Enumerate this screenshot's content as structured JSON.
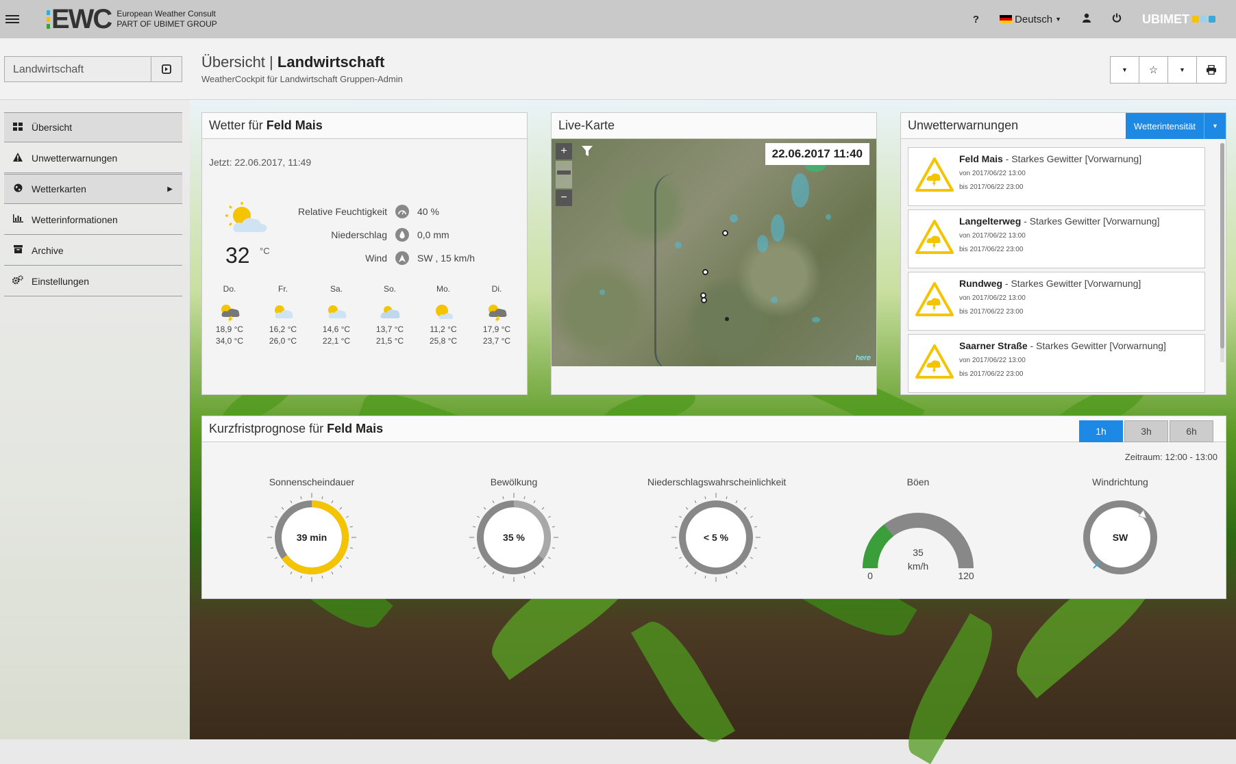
{
  "topbar": {
    "brand": "EWC",
    "brand_sub1": "European Weather Consult",
    "brand_sub2": "PART OF UBIMET GROUP",
    "help": "?",
    "language": "Deutsch",
    "partner": "UBIMET",
    "colors": {
      "bar1": "#3aa8d8",
      "bar2": "#f0c010",
      "bar3": "#3a9e3a"
    }
  },
  "header": {
    "group_select": "Landwirtschaft",
    "title_prefix": "Übersicht",
    "title_sep": "|",
    "title_main": "Landwirtschaft",
    "subtitle": "WeatherCockpit für Landwirtschaft Gruppen-Admin"
  },
  "sidebar": {
    "items": [
      {
        "label": "Übersicht",
        "icon": "dashboard-icon"
      },
      {
        "label": "Unwetterwarnungen",
        "icon": "warning-icon"
      },
      {
        "label": "Wetterkarten",
        "icon": "globe-icon"
      },
      {
        "label": "Wetterinformationen",
        "icon": "bar-chart-icon"
      },
      {
        "label": "Archive",
        "icon": "archive-icon"
      },
      {
        "label": "Einstellungen",
        "icon": "settings-icon"
      }
    ]
  },
  "weather": {
    "title_prefix": "Wetter für",
    "title_place": "Feld Mais",
    "now": "Jetzt: 22.06.2017, 11:49",
    "temp": "32",
    "temp_unit": "°C",
    "details": [
      {
        "label": "Relative Feuchtigkeit",
        "value": "40 %"
      },
      {
        "label": "Niederschlag",
        "value": "0,0 mm"
      },
      {
        "label": "Wind",
        "value": "SW , 15 km/h"
      }
    ],
    "forecast": [
      {
        "day": "Do.",
        "min": "18,9 °C",
        "max": "34,0 °C",
        "icon": "thunder"
      },
      {
        "day": "Fr.",
        "min": "16,2 °C",
        "max": "26,0 °C",
        "icon": "partly"
      },
      {
        "day": "Sa.",
        "min": "14,6 °C",
        "max": "22,1 °C",
        "icon": "partly"
      },
      {
        "day": "So.",
        "min": "13,7 °C",
        "max": "21,5 °C",
        "icon": "cloudy"
      },
      {
        "day": "Mo.",
        "min": "11,2 °C",
        "max": "25,8 °C",
        "icon": "sunny"
      },
      {
        "day": "Di.",
        "min": "17,9 °C",
        "max": "23,7 °C",
        "icon": "thunder"
      }
    ]
  },
  "map": {
    "title": "Live-Karte",
    "timestamp": "22.06.2017 11:40",
    "zoom_in": "+",
    "zoom_out": "−",
    "attribution": "here"
  },
  "warnings": {
    "title": "Unwetterwarnungen",
    "button": "Wetterintensität",
    "items": [
      {
        "place": "Feld Mais",
        "text": " - Starkes Gewitter [Vorwarnung]",
        "from": "von 2017/06/22 13:00",
        "until": "bis 2017/06/22 23:00"
      },
      {
        "place": "Langelterweg",
        "text": " - Starkes Gewitter [Vorwarnung]",
        "from": "von 2017/06/22 13:00",
        "until": "bis 2017/06/22 23:00"
      },
      {
        "place": "Rundweg",
        "text": " - Starkes Gewitter [Vorwarnung]",
        "from": "von 2017/06/22 13:00",
        "until": "bis 2017/06/22 23:00"
      },
      {
        "place": "Saarner Straße",
        "text": " - Starkes Gewitter [Vorwarnung]",
        "from": "von 2017/06/22 13:00",
        "until": "bis 2017/06/22 23:00"
      }
    ]
  },
  "shortforecast": {
    "title_prefix": "Kurzfristprognose für",
    "title_place": "Feld Mais",
    "tabs": [
      "1h",
      "3h",
      "6h"
    ],
    "period": "Zeitraum: 12:00 - 13:00",
    "gauges": {
      "sun": {
        "label": "Sonnenscheindauer",
        "value_text": "39 min",
        "fraction": 0.65,
        "color": "#f5c400"
      },
      "cloud": {
        "label": "Bewölkung",
        "value_text": "35 %",
        "fraction": 0.35,
        "color": "#a8a8a8"
      },
      "rain": {
        "label": "Niederschlagswahrscheinlichkeit",
        "value_text": "< 5 %",
        "fraction": 0.0,
        "color": "#888888"
      },
      "gust": {
        "label": "Böen",
        "value": "35",
        "unit": "km/h",
        "min": "0",
        "max": "120",
        "fraction": 0.29,
        "color": "#3a9e3a"
      },
      "wind": {
        "label": "Windrichtung",
        "value_text": "SW"
      }
    }
  }
}
